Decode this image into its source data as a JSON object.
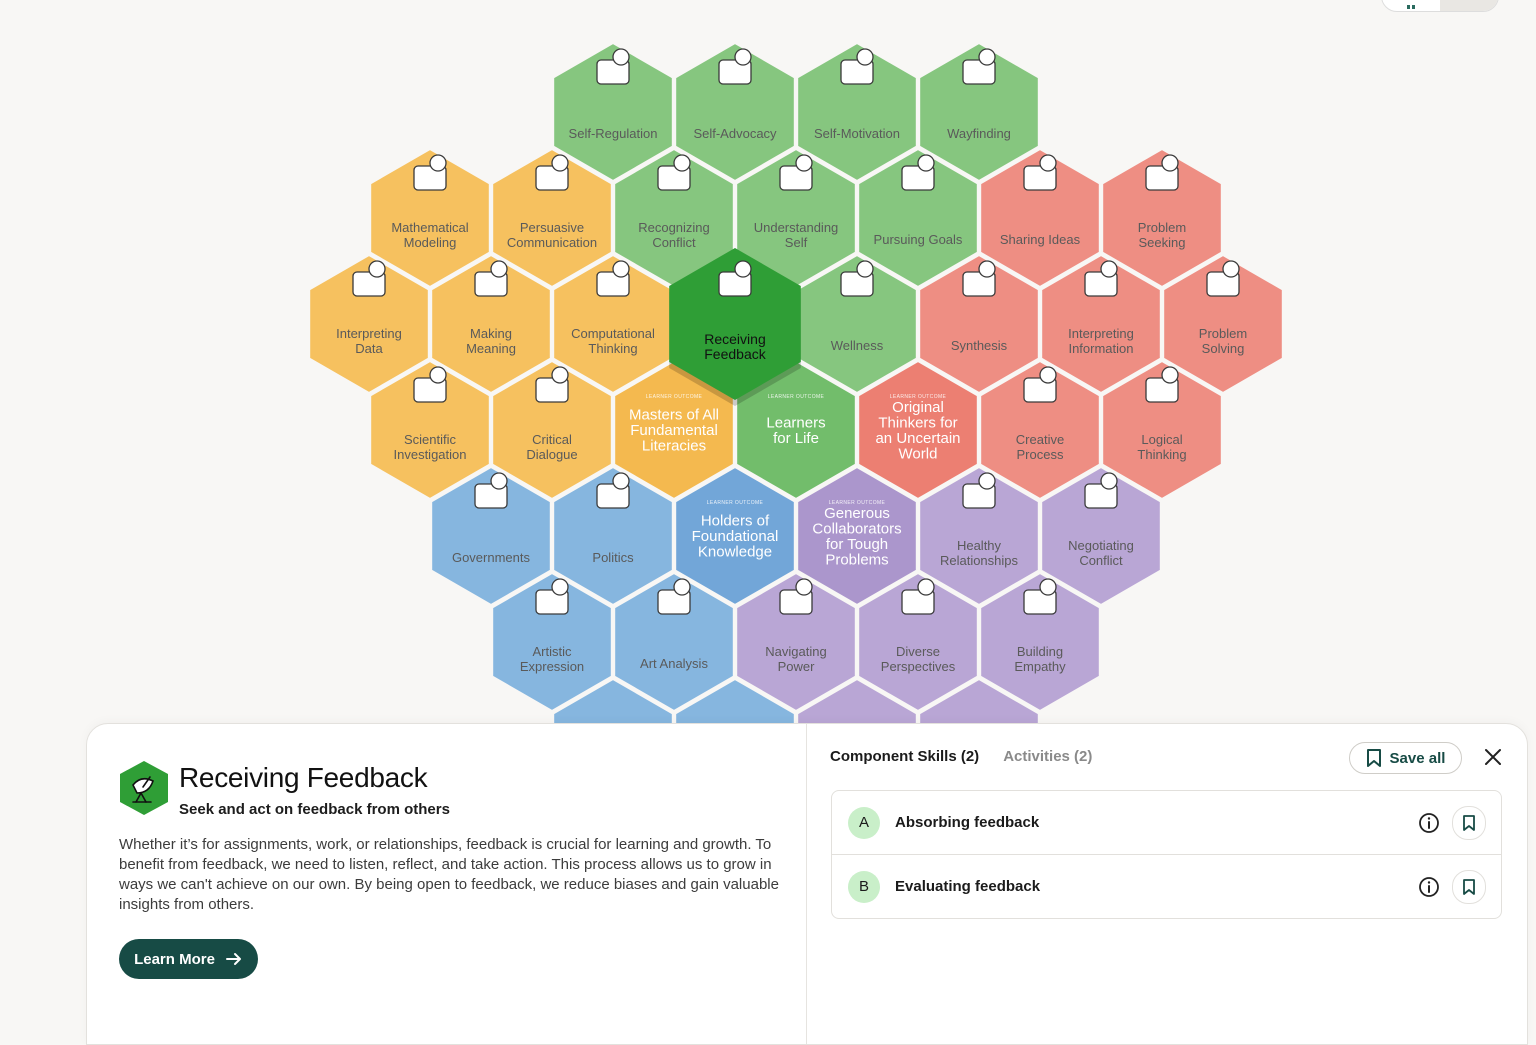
{
  "hexes": [
    {
      "key": "self-regulation",
      "label": [
        "Self-Regulation"
      ],
      "color": "green"
    },
    {
      "key": "self-advocacy",
      "label": [
        "Self-Advocacy"
      ],
      "color": "green"
    },
    {
      "key": "self-motivation",
      "label": [
        "Self-Motivation"
      ],
      "color": "green"
    },
    {
      "key": "wayfinding",
      "label": [
        "Wayfinding"
      ],
      "color": "green"
    },
    {
      "key": "mathematical-modeling",
      "label": [
        "Mathematical",
        "Modeling"
      ],
      "color": "yellow"
    },
    {
      "key": "persuasive-communication",
      "label": [
        "Persuasive",
        "Communication"
      ],
      "color": "yellow"
    },
    {
      "key": "recognizing-conflict",
      "label": [
        "Recognizing",
        "Conflict"
      ],
      "color": "green"
    },
    {
      "key": "understanding-self",
      "label": [
        "Understanding",
        "Self"
      ],
      "color": "green"
    },
    {
      "key": "pursuing-goals",
      "label": [
        "Pursuing Goals"
      ],
      "color": "green"
    },
    {
      "key": "sharing-ideas",
      "label": [
        "Sharing Ideas"
      ],
      "color": "red"
    },
    {
      "key": "problem-seeking",
      "label": [
        "Problem",
        "Seeking"
      ],
      "color": "red"
    },
    {
      "key": "interpreting-data",
      "label": [
        "Interpreting",
        "Data"
      ],
      "color": "yellow"
    },
    {
      "key": "making-meaning",
      "label": [
        "Making",
        "Meaning"
      ],
      "color": "yellow"
    },
    {
      "key": "computational-thinking",
      "label": [
        "Computational",
        "Thinking"
      ],
      "color": "yellow"
    },
    {
      "key": "receiving-feedback",
      "label": [
        "Receiving",
        "Feedback"
      ],
      "color": "active"
    },
    {
      "key": "wellness",
      "label": [
        "Wellness"
      ],
      "color": "green"
    },
    {
      "key": "synthesis",
      "label": [
        "Synthesis"
      ],
      "color": "red"
    },
    {
      "key": "interpreting-information",
      "label": [
        "Interpreting",
        "Information"
      ],
      "color": "red"
    },
    {
      "key": "problem-solving",
      "label": [
        "Problem",
        "Solving"
      ],
      "color": "red"
    },
    {
      "key": "scientific-investigation",
      "label": [
        "Scientific",
        "Investigation"
      ],
      "color": "yellow"
    },
    {
      "key": "critical-dialogue",
      "label": [
        "Critical",
        "Dialogue"
      ],
      "color": "yellow"
    },
    {
      "key": "masters-of-all",
      "label": [
        "Masters of All",
        "Fundamental",
        "Literacies"
      ],
      "color": "outcome-yellow",
      "tag": "LEARNER OUTCOME"
    },
    {
      "key": "learners-for-life",
      "label": [
        "Learners",
        "for Life"
      ],
      "color": "outcome-green",
      "tag": "LEARNER OUTCOME"
    },
    {
      "key": "original-thinkers",
      "label": [
        "Original",
        "Thinkers for",
        "an Uncertain",
        "World"
      ],
      "color": "outcome-red",
      "tag": "LEARNER OUTCOME"
    },
    {
      "key": "creative-process",
      "label": [
        "Creative",
        "Process"
      ],
      "color": "red"
    },
    {
      "key": "logical-thinking",
      "label": [
        "Logical",
        "Thinking"
      ],
      "color": "red"
    },
    {
      "key": "governments",
      "label": [
        "Governments"
      ],
      "color": "blue"
    },
    {
      "key": "politics",
      "label": [
        "Politics"
      ],
      "color": "blue"
    },
    {
      "key": "holders-of-knowledge",
      "label": [
        "Holders of",
        "Foundational",
        "Knowledge"
      ],
      "color": "outcome-blue",
      "tag": "LEARNER OUTCOME"
    },
    {
      "key": "generous-collaborators",
      "label": [
        "Generous",
        "Collaborators",
        "for Tough",
        "Problems"
      ],
      "color": "outcome-purple",
      "tag": "LEARNER OUTCOME"
    },
    {
      "key": "healthy-relationships",
      "label": [
        "Healthy",
        "Relationships"
      ],
      "color": "purple"
    },
    {
      "key": "negotiating-conflict",
      "label": [
        "Negotiating",
        "Conflict"
      ],
      "color": "purple"
    },
    {
      "key": "artistic-expression",
      "label": [
        "Artistic",
        "Expression"
      ],
      "color": "blue"
    },
    {
      "key": "art-analysis",
      "label": [
        "Art Analysis"
      ],
      "color": "blue"
    },
    {
      "key": "navigating-power",
      "label": [
        "Navigating",
        "Power"
      ],
      "color": "purple"
    },
    {
      "key": "diverse-perspectives",
      "label": [
        "Diverse",
        "Perspectives"
      ],
      "color": "purple"
    },
    {
      "key": "building-empathy",
      "label": [
        "Building",
        "Empathy"
      ],
      "color": "purple"
    },
    {
      "key": "partial-1",
      "label": [],
      "color": "blue"
    },
    {
      "key": "partial-2",
      "label": [],
      "color": "blue"
    },
    {
      "key": "partial-3",
      "label": [],
      "color": "purple"
    },
    {
      "key": "partial-4",
      "label": [],
      "color": "purple"
    }
  ],
  "colors": {
    "green": "#86c67f",
    "yellow": "#f6c15f",
    "red": "#ee8e83",
    "blue": "#86b6df",
    "purple": "#b9a6d5",
    "active": "#2f9e36",
    "outcome-yellow": "#f4b94f",
    "outcome-green": "#72bd6b",
    "outcome-red": "#ec7f72",
    "outcome-blue": "#72a6d8",
    "outcome-purple": "#ab96cc",
    "button": "#174b45",
    "badge": "#c9efc9"
  },
  "panel": {
    "title": "Receiving Feedback",
    "subtitle": "Seek and act on feedback from others",
    "description": "Whether it’s for assignments, work, or relationships, feedback is crucial for learning and growth. To benefit from feedback, we need to listen, reflect, and take action. This process allows us to grow in ways we can't achieve on our own. By being open to feedback, we reduce biases and gain valuable insights from others.",
    "learn_more": "Learn More"
  },
  "tabs": {
    "components": "Component Skills (2)",
    "activities": "Activities (2)",
    "save_all": "Save all"
  },
  "component_skills": [
    {
      "letter": "A",
      "label": "Absorbing feedback"
    },
    {
      "letter": "B",
      "label": "Evaluating feedback"
    }
  ]
}
